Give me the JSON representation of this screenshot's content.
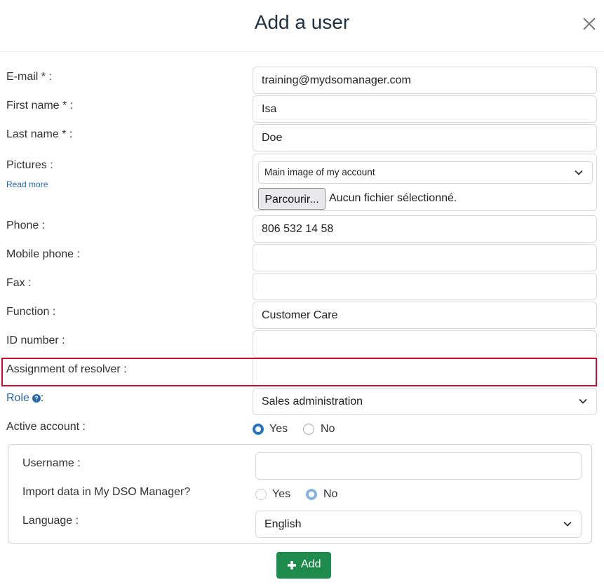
{
  "dialog": {
    "title": "Add a user",
    "close_icon": "close-icon"
  },
  "fields": {
    "email": {
      "label": "E-mail * :",
      "value": "training@mydsomanager.com"
    },
    "first_name": {
      "label": "First name * :",
      "value": "Isa"
    },
    "last_name": {
      "label": "Last name * :",
      "value": "Doe"
    },
    "pictures": {
      "label": "Pictures :",
      "read_more": "Read more",
      "select_value": "Main image of my account",
      "browse_label": "Parcourir...",
      "file_status": "Aucun fichier sélectionné."
    },
    "phone": {
      "label": "Phone :",
      "value": "806 532 14 58"
    },
    "mobile_phone": {
      "label": "Mobile phone :",
      "value": ""
    },
    "fax": {
      "label": "Fax :",
      "value": ""
    },
    "function": {
      "label": "Function :",
      "value": "Customer Care"
    },
    "id_number": {
      "label": "ID number :",
      "value": ""
    },
    "assignment_of_resolver": {
      "label": "Assignment of resolver :",
      "value": ""
    },
    "role": {
      "label": "Role",
      "suffix": ":",
      "help_icon": "help-icon",
      "value": "Sales administration"
    },
    "active_account": {
      "label": "Active account :",
      "yes": "Yes",
      "no": "No",
      "selected": "Yes"
    }
  },
  "account_panel": {
    "username": {
      "label": "Username :",
      "value": ""
    },
    "import_data": {
      "label": "Import data in My DSO Manager?",
      "yes": "Yes",
      "no": "No",
      "selected": "No"
    },
    "language": {
      "label": "Language :",
      "value": "English"
    }
  },
  "actions": {
    "add_label": "Add",
    "add_icon": "plus-icon",
    "add_color": "#1e8a4c"
  },
  "colors": {
    "highlight": "#c8102e",
    "link": "#2a67a8"
  }
}
